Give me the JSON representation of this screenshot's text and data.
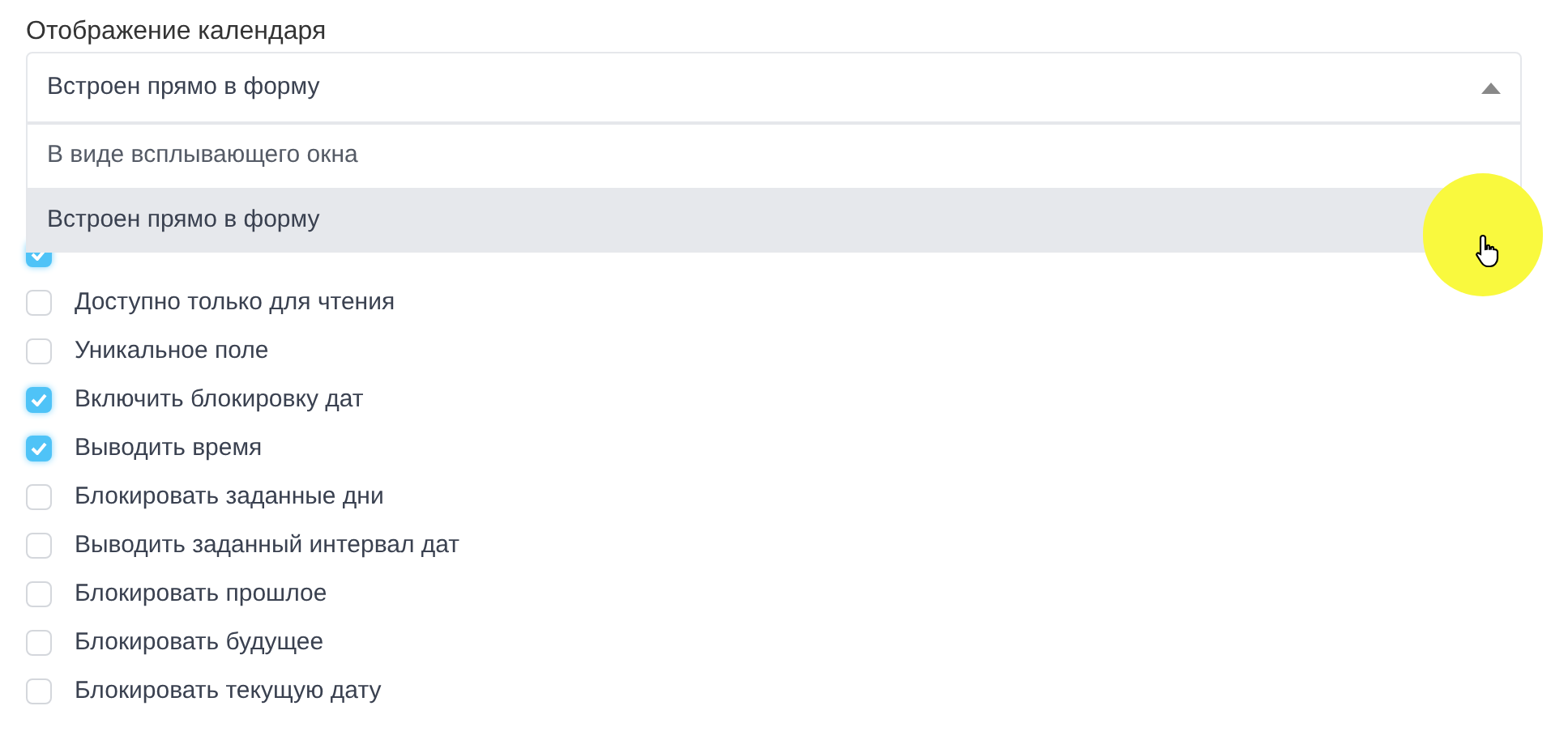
{
  "title": "Отображение календаря",
  "select": {
    "value": "Встроен прямо в форму",
    "expanded": true,
    "options": [
      {
        "label": "В виде всплывающего окна",
        "selected": false
      },
      {
        "label": "Встроен прямо в форму",
        "selected": true
      }
    ]
  },
  "checkboxes": [
    {
      "checked": true
    },
    {
      "label": "Доступно только для чтения",
      "checked": false
    },
    {
      "label": "Уникальное поле",
      "checked": false
    },
    {
      "label": "Включить блокировку дат",
      "checked": true
    },
    {
      "label": "Выводить время",
      "checked": true
    },
    {
      "label": "Блокировать заданные дни",
      "checked": false
    },
    {
      "label": "Выводить заданный интервал дат",
      "checked": false
    },
    {
      "label": "Блокировать прошлое",
      "checked": false
    },
    {
      "label": "Блокировать будущее",
      "checked": false
    },
    {
      "label": "Блокировать текущую дату",
      "checked": false
    }
  ]
}
